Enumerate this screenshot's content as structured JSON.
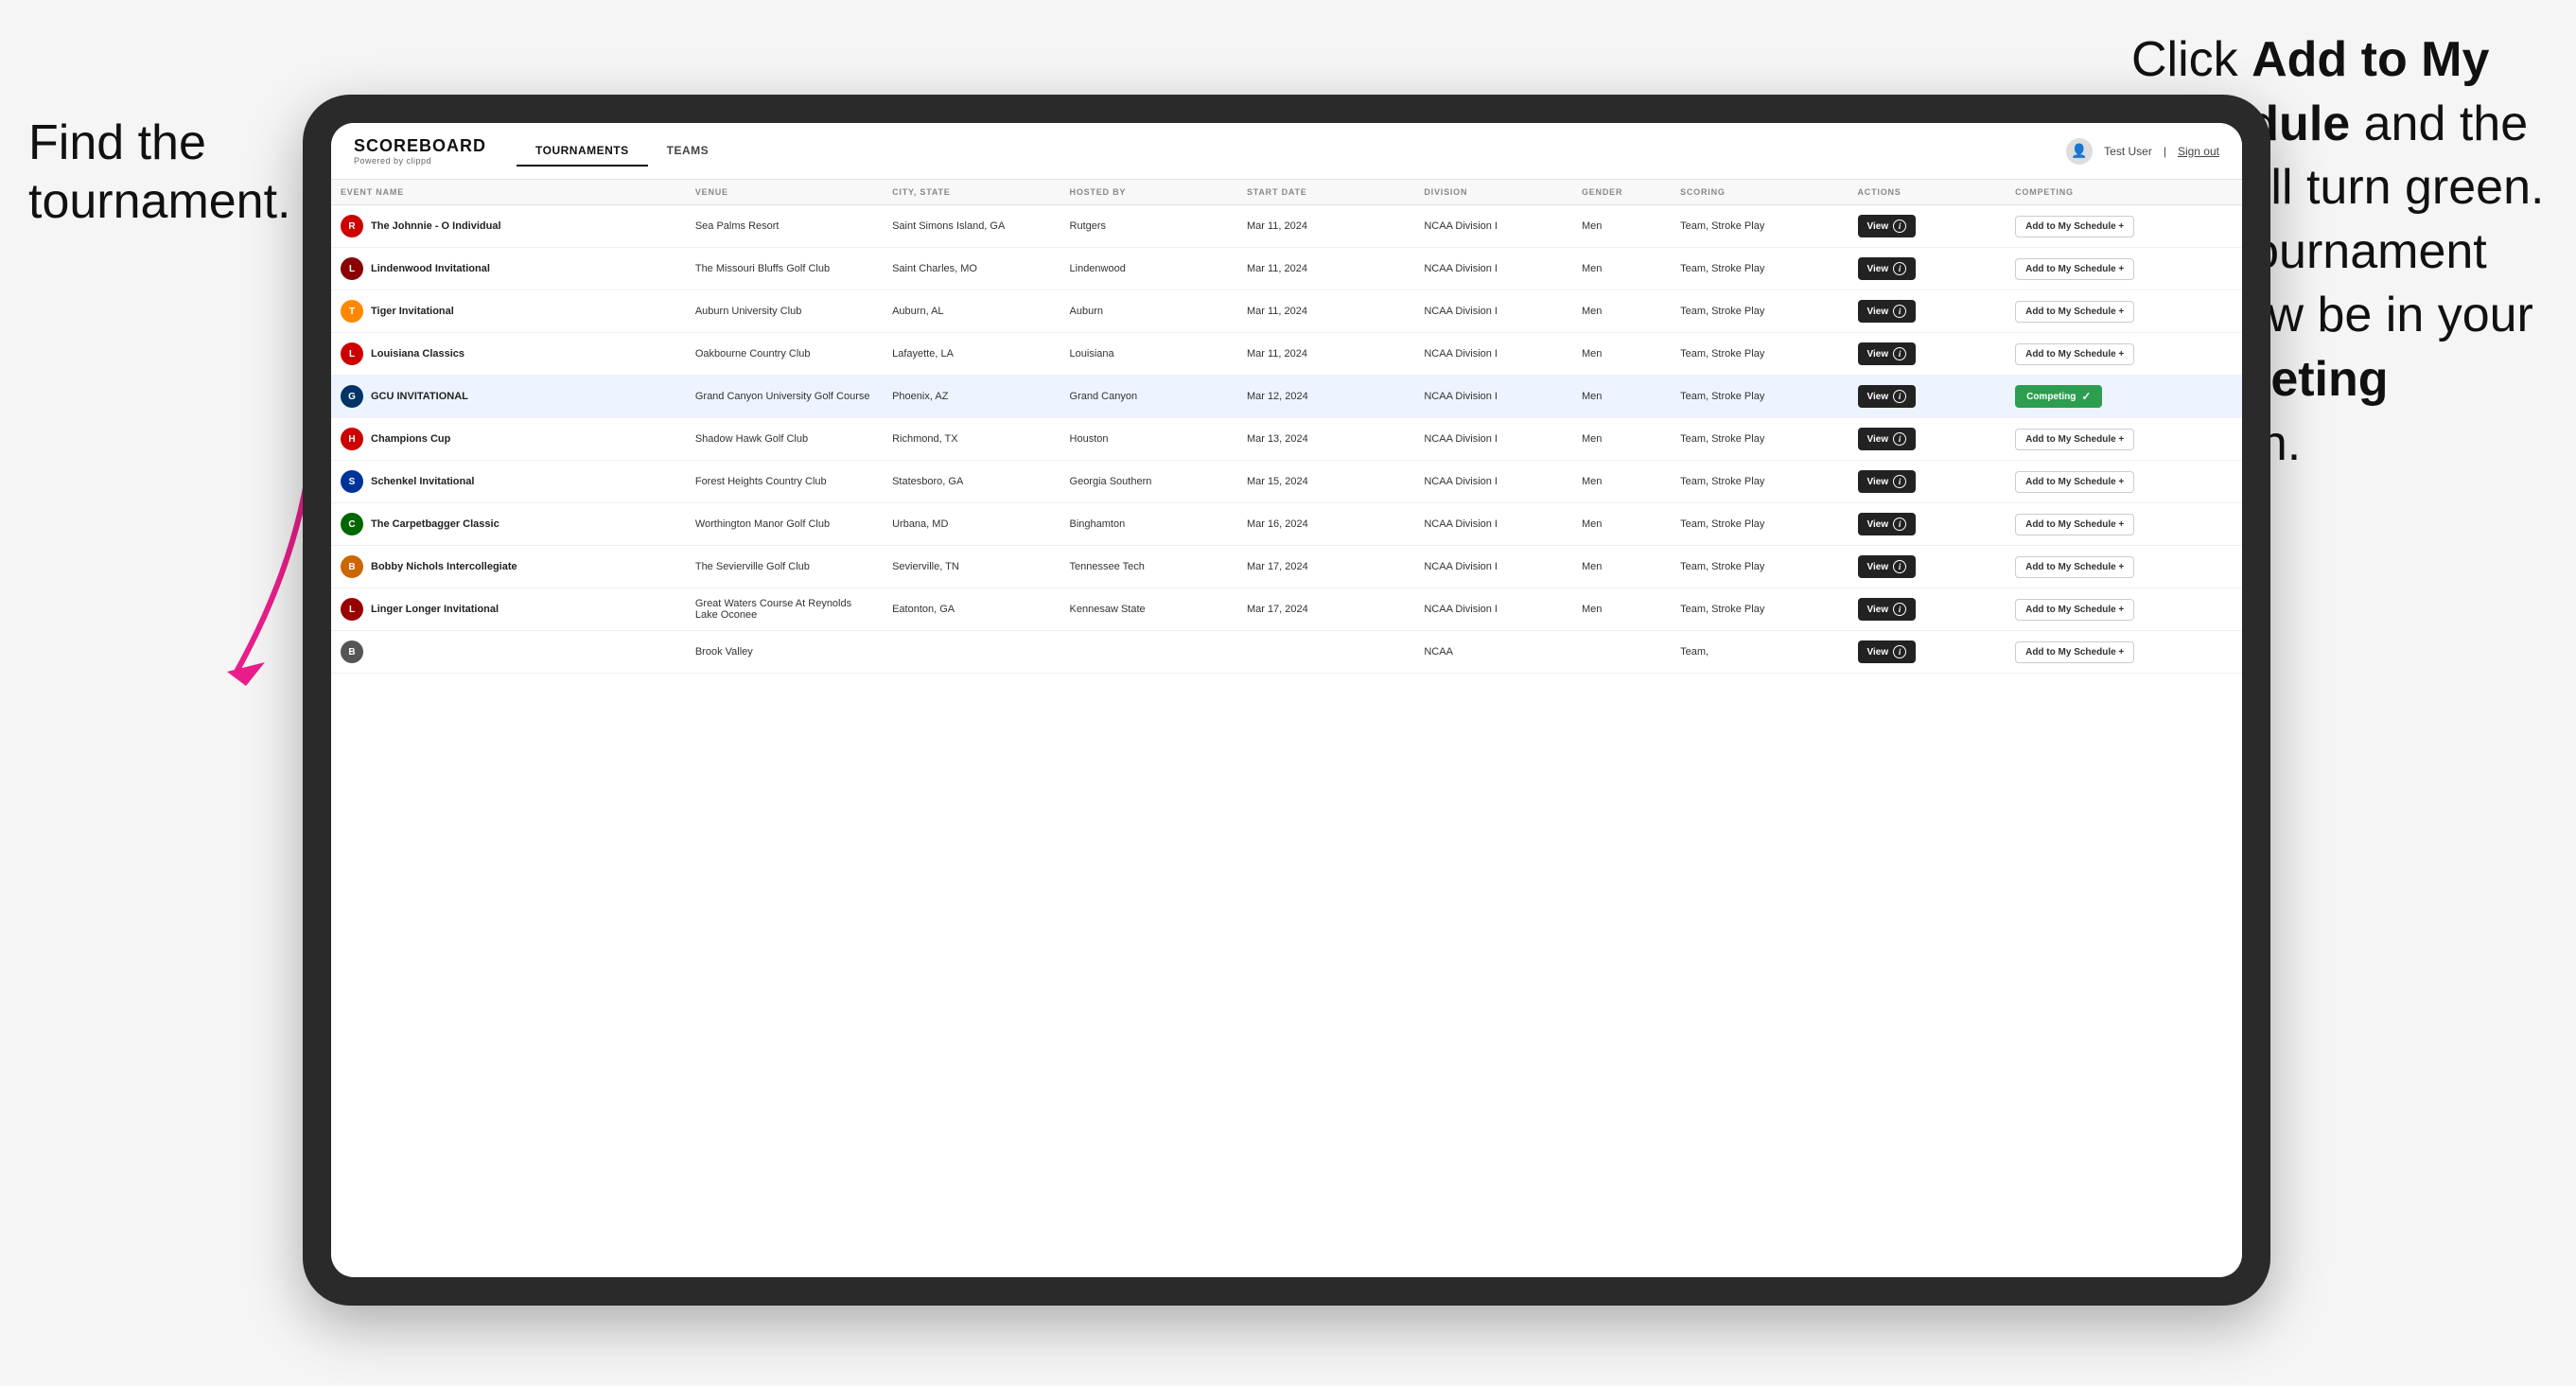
{
  "instructions": {
    "left_text": "Find the tournament.",
    "right_line1": "Click ",
    "right_bold1": "Add to My Schedule",
    "right_line2": " and the box will turn green. This tournament will now be in your ",
    "right_bold2": "Competing",
    "right_line3": " section."
  },
  "app": {
    "logo": "SCOREBOARD",
    "logo_sub": "Powered by clippd",
    "nav_tabs": [
      "TOURNAMENTS",
      "TEAMS"
    ],
    "active_tab": "TOURNAMENTS",
    "user_label": "Test User",
    "signout_label": "Sign out"
  },
  "table": {
    "columns": [
      "EVENT NAME",
      "VENUE",
      "CITY, STATE",
      "HOSTED BY",
      "START DATE",
      "DIVISION",
      "GENDER",
      "SCORING",
      "ACTIONS",
      "COMPETING"
    ],
    "rows": [
      {
        "logo_color": "#cc0000",
        "logo_letter": "R",
        "event_name": "The Johnnie - O Individual",
        "venue": "Sea Palms Resort",
        "city_state": "Saint Simons Island, GA",
        "hosted_by": "Rutgers",
        "start_date": "Mar 11, 2024",
        "division": "NCAA Division I",
        "gender": "Men",
        "scoring": "Team, Stroke Play",
        "action": "View",
        "competing_status": "add",
        "competing_label": "Add to My Schedule +"
      },
      {
        "logo_color": "#8b0000",
        "logo_letter": "L",
        "event_name": "Lindenwood Invitational",
        "venue": "The Missouri Bluffs Golf Club",
        "city_state": "Saint Charles, MO",
        "hosted_by": "Lindenwood",
        "start_date": "Mar 11, 2024",
        "division": "NCAA Division I",
        "gender": "Men",
        "scoring": "Team, Stroke Play",
        "action": "View",
        "competing_status": "add",
        "competing_label": "Add to My Schedule +"
      },
      {
        "logo_color": "#ff8800",
        "logo_letter": "T",
        "event_name": "Tiger Invitational",
        "venue": "Auburn University Club",
        "city_state": "Auburn, AL",
        "hosted_by": "Auburn",
        "start_date": "Mar 11, 2024",
        "division": "NCAA Division I",
        "gender": "Men",
        "scoring": "Team, Stroke Play",
        "action": "View",
        "competing_status": "add",
        "competing_label": "Add to My Schedule +"
      },
      {
        "logo_color": "#cc0000",
        "logo_letter": "L",
        "event_name": "Louisiana Classics",
        "venue": "Oakbourne Country Club",
        "city_state": "Lafayette, LA",
        "hosted_by": "Louisiana",
        "start_date": "Mar 11, 2024",
        "division": "NCAA Division I",
        "gender": "Men",
        "scoring": "Team, Stroke Play",
        "action": "View",
        "competing_status": "add",
        "competing_label": "Add to My Schedule +"
      },
      {
        "logo_color": "#003366",
        "logo_letter": "G",
        "event_name": "GCU INVITATIONAL",
        "venue": "Grand Canyon University Golf Course",
        "city_state": "Phoenix, AZ",
        "hosted_by": "Grand Canyon",
        "start_date": "Mar 12, 2024",
        "division": "NCAA Division I",
        "gender": "Men",
        "scoring": "Team, Stroke Play",
        "action": "View",
        "competing_status": "competing",
        "competing_label": "Competing ✓",
        "highlighted": true
      },
      {
        "logo_color": "#cc0000",
        "logo_letter": "H",
        "event_name": "Champions Cup",
        "venue": "Shadow Hawk Golf Club",
        "city_state": "Richmond, TX",
        "hosted_by": "Houston",
        "start_date": "Mar 13, 2024",
        "division": "NCAA Division I",
        "gender": "Men",
        "scoring": "Team, Stroke Play",
        "action": "View",
        "competing_status": "add",
        "competing_label": "Add to My Schedule +"
      },
      {
        "logo_color": "#003399",
        "logo_letter": "S",
        "event_name": "Schenkel Invitational",
        "venue": "Forest Heights Country Club",
        "city_state": "Statesboro, GA",
        "hosted_by": "Georgia Southern",
        "start_date": "Mar 15, 2024",
        "division": "NCAA Division I",
        "gender": "Men",
        "scoring": "Team, Stroke Play",
        "action": "View",
        "competing_status": "add",
        "competing_label": "Add to My Schedule +"
      },
      {
        "logo_color": "#006600",
        "logo_letter": "C",
        "event_name": "The Carpetbagger Classic",
        "venue": "Worthington Manor Golf Club",
        "city_state": "Urbana, MD",
        "hosted_by": "Binghamton",
        "start_date": "Mar 16, 2024",
        "division": "NCAA Division I",
        "gender": "Men",
        "scoring": "Team, Stroke Play",
        "action": "View",
        "competing_status": "add",
        "competing_label": "Add to My Schedule +"
      },
      {
        "logo_color": "#cc6600",
        "logo_letter": "B",
        "event_name": "Bobby Nichols Intercollegiate",
        "venue": "The Sevierville Golf Club",
        "city_state": "Sevierville, TN",
        "hosted_by": "Tennessee Tech",
        "start_date": "Mar 17, 2024",
        "division": "NCAA Division I",
        "gender": "Men",
        "scoring": "Team, Stroke Play",
        "action": "View",
        "competing_status": "add",
        "competing_label": "Add to My Schedule +"
      },
      {
        "logo_color": "#990000",
        "logo_letter": "L",
        "event_name": "Linger Longer Invitational",
        "venue": "Great Waters Course At Reynolds Lake Oconee",
        "city_state": "Eatonton, GA",
        "hosted_by": "Kennesaw State",
        "start_date": "Mar 17, 2024",
        "division": "NCAA Division I",
        "gender": "Men",
        "scoring": "Team, Stroke Play",
        "action": "View",
        "competing_status": "add",
        "competing_label": "Add to My Schedule +"
      },
      {
        "logo_color": "#555555",
        "logo_letter": "B",
        "event_name": "",
        "venue": "Brook Valley",
        "city_state": "",
        "hosted_by": "",
        "start_date": "",
        "division": "NCAA",
        "gender": "",
        "scoring": "Team,",
        "action": "View",
        "competing_status": "add",
        "competing_label": "Add to My Schedule +"
      }
    ]
  }
}
